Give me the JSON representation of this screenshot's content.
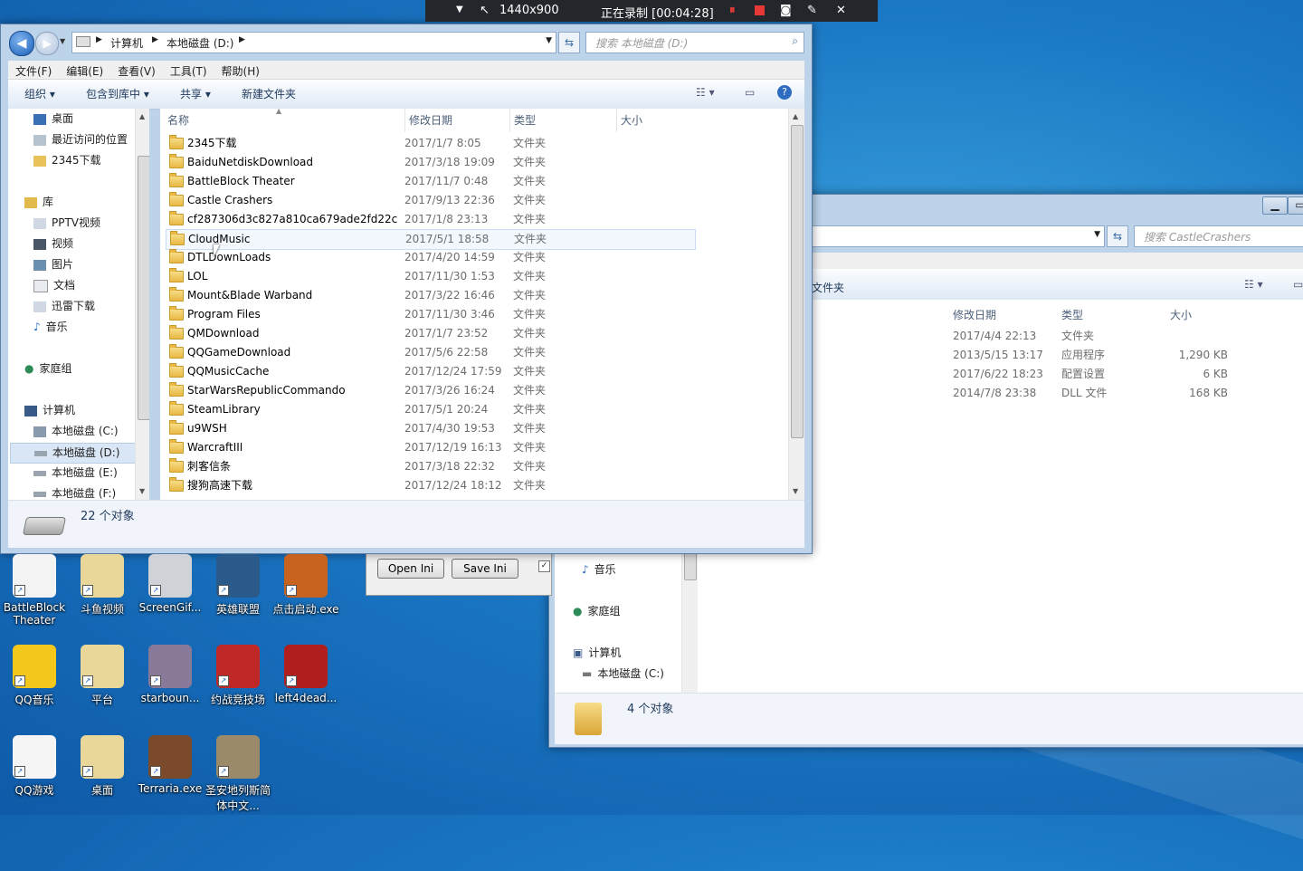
{
  "recorder": {
    "resolution": "1440x900",
    "status": "正在录制 [00:04:28]"
  },
  "explorer_main": {
    "breadcrumb": [
      "计算机",
      "本地磁盘 (D:)"
    ],
    "search_placeholder": "搜索 本地磁盘 (D:)",
    "menu": [
      "文件(F)",
      "编辑(E)",
      "查看(V)",
      "工具(T)",
      "帮助(H)"
    ],
    "commands": [
      "组织 ▾",
      "包含到库中 ▾",
      "共享 ▾",
      "新建文件夹"
    ],
    "nav": {
      "favorites": [
        "桌面",
        "最近访问的位置",
        "2345下载"
      ],
      "library_header": "库",
      "libraries": [
        "PPTV视频",
        "视频",
        "图片",
        "文档",
        "迅雷下载",
        "音乐"
      ],
      "homegroup": "家庭组",
      "computer_header": "计算机",
      "drives": [
        "本地磁盘 (C:)",
        "本地磁盘 (D:)",
        "本地磁盘 (E:)",
        "本地磁盘 (F:)"
      ]
    },
    "columns": [
      "名称",
      "修改日期",
      "类型",
      "大小"
    ],
    "files": [
      {
        "name": "2345下载",
        "date": "2017/1/7 8:05",
        "type": "文件夹"
      },
      {
        "name": "BaiduNetdiskDownload",
        "date": "2017/3/18 19:09",
        "type": "文件夹"
      },
      {
        "name": "BattleBlock Theater",
        "date": "2017/11/7 0:48",
        "type": "文件夹"
      },
      {
        "name": "Castle Crashers",
        "date": "2017/9/13 22:36",
        "type": "文件夹"
      },
      {
        "name": "cf287306d3c827a810ca679ade2fd22c",
        "date": "2017/1/8 23:13",
        "type": "文件夹"
      },
      {
        "name": "CloudMusic",
        "date": "2017/5/1 18:58",
        "type": "文件夹"
      },
      {
        "name": "DTLDownLoads",
        "date": "2017/4/20 14:59",
        "type": "文件夹"
      },
      {
        "name": "LOL",
        "date": "2017/11/30 1:53",
        "type": "文件夹"
      },
      {
        "name": "Mount&Blade Warband",
        "date": "2017/3/22 16:46",
        "type": "文件夹"
      },
      {
        "name": "Program Files",
        "date": "2017/11/30 3:46",
        "type": "文件夹"
      },
      {
        "name": "QMDownload",
        "date": "2017/1/7 23:52",
        "type": "文件夹"
      },
      {
        "name": "QQGameDownload",
        "date": "2017/5/6 22:58",
        "type": "文件夹"
      },
      {
        "name": "QQMusicCache",
        "date": "2017/12/24 17:59",
        "type": "文件夹"
      },
      {
        "name": "StarWarsRepublicCommando",
        "date": "2017/3/26 16:24",
        "type": "文件夹"
      },
      {
        "name": "SteamLibrary",
        "date": "2017/5/1 20:24",
        "type": "文件夹"
      },
      {
        "name": "u9WSH",
        "date": "2017/4/30 19:53",
        "type": "文件夹"
      },
      {
        "name": "WarcraftIII",
        "date": "2017/12/19 16:13",
        "type": "文件夹"
      },
      {
        "name": "刺客信条",
        "date": "2017/3/18 22:32",
        "type": "文件夹"
      },
      {
        "name": "搜狗高速下载",
        "date": "2017/12/24 18:12",
        "type": "文件夹"
      }
    ],
    "status": "22 个对象"
  },
  "explorer_back": {
    "search_placeholder": "搜索 CastleCrashers",
    "command_label": "文件夹",
    "columns": [
      "修改日期",
      "类型",
      "大小"
    ],
    "files": [
      {
        "date": "2017/4/4 22:13",
        "type": "文件夹",
        "size": ""
      },
      {
        "date": "2013/5/15 13:17",
        "type": "应用程序",
        "size": "1,290 KB"
      },
      {
        "date": "2017/6/22 18:23",
        "type": "配置设置",
        "size": "6 KB"
      },
      {
        "date": "2014/7/8 23:38",
        "type": "DLL 文件",
        "size": "168 KB"
      }
    ],
    "nav": [
      "音乐",
      "家庭组",
      "计算机",
      "本地磁盘 (C:)"
    ],
    "status": "4 个对象"
  },
  "small_dialog": {
    "open_label": "Open Ini",
    "save_label": "Save Ini"
  },
  "desktop_icons": [
    {
      "label": "BattleBlock Theater",
      "color": "#f3f3f3"
    },
    {
      "label": "斗鱼视频",
      "color": "#e9d79a"
    },
    {
      "label": "ScreenGif...",
      "color": "#cfd3d8"
    },
    {
      "label": "英雄联盟",
      "color": "#2a5a8a"
    },
    {
      "label": "点击启动.exe",
      "color": "#c8621f"
    },
    {
      "label": "QQ音乐",
      "color": "#f4c81a"
    },
    {
      "label": "平台",
      "color": "#e9d79a"
    },
    {
      "label": "starboun...",
      "color": "#8a7a9a"
    },
    {
      "label": "约战竞技场",
      "color": "#c02828"
    },
    {
      "label": "left4dead...",
      "color": "#b01e1e"
    },
    {
      "label": "QQ游戏",
      "color": "#f5f5f5"
    },
    {
      "label": "桌面",
      "color": "#e9d79a"
    },
    {
      "label": "Terraria.exe",
      "color": "#7a4a2a"
    },
    {
      "label": "圣安地列斯简体中文...",
      "color": "#9a8a6a"
    }
  ]
}
